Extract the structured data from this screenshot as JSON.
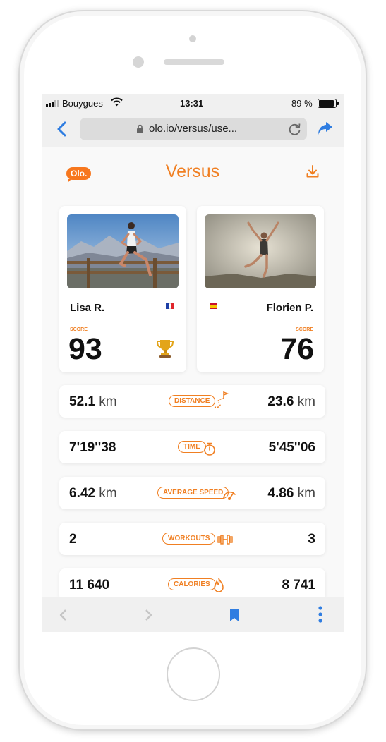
{
  "status_bar": {
    "carrier": "Bouygues",
    "time": "13:31",
    "battery": "89 %"
  },
  "browser": {
    "url": "olo.io/versus/use..."
  },
  "header": {
    "logo": "Olo.",
    "title": "Versus"
  },
  "players": [
    {
      "name": "Lisa R.",
      "score_label": "SCORE",
      "score": "93",
      "country": "France"
    },
    {
      "name": "Florien P.",
      "score_label": "SCORE",
      "score": "76",
      "country": "Spain"
    }
  ],
  "stats": [
    {
      "label": "DISTANCE",
      "icon": "route-flag-icon",
      "left_value": "52.1",
      "left_unit": "km",
      "right_value": "23.6",
      "right_unit": "km"
    },
    {
      "label": "TIME",
      "icon": "stopwatch-icon",
      "left_value": "7'19''38",
      "left_unit": "",
      "right_value": "5'45''06",
      "right_unit": ""
    },
    {
      "label": "AVERAGE SPEED",
      "icon": "speedometer-icon",
      "left_value": "6.42",
      "left_unit": "km",
      "right_value": "4.86",
      "right_unit": "km"
    },
    {
      "label": "WORKOUTS",
      "icon": "dumbbell-icon",
      "left_value": "2",
      "left_unit": "",
      "right_value": "3",
      "right_unit": ""
    },
    {
      "label": "CALORIES",
      "icon": "flame-icon",
      "left_value": "11 640",
      "left_unit": "",
      "right_value": "8 741",
      "right_unit": ""
    }
  ],
  "colors": {
    "accent": "#f07f22",
    "ios_blue": "#2f7de1",
    "background": "#f9f9f9"
  }
}
